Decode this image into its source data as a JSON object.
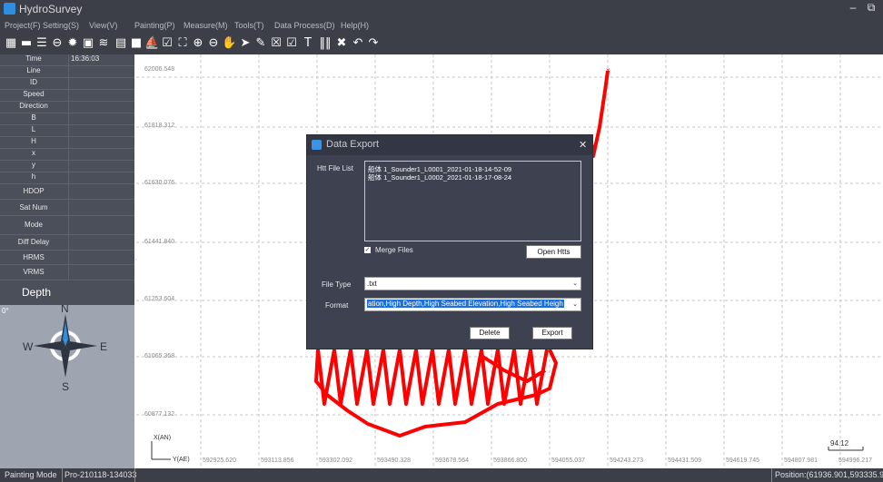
{
  "app": {
    "title": "HydroSurvey",
    "minimize": "–",
    "restore": "⧉"
  },
  "menu": [
    "Project(F)",
    "Setting(S)",
    "View(V)",
    "Painting(P)",
    "Measure(M)",
    "Tools(T)",
    "Data Process(D)",
    "Help(H)"
  ],
  "toolbar_icons": [
    "open-project-icon",
    "save-icon",
    "layers-icon",
    "link-icon",
    "settings-gear-icon",
    "image-icon",
    "lines-icon",
    "document-icon",
    "camera-icon",
    "boat-icon",
    "edit-icon",
    "fullscreen-icon",
    "zoom-in-icon",
    "zoom-out-icon",
    "pan-hand-icon",
    "pointer-icon",
    "pen-icon",
    "draw-icon",
    "edit-box-icon",
    "text-tool-icon",
    "barcode-icon",
    "delete-icon",
    "undo-icon",
    "redo-icon"
  ],
  "left_panel": {
    "rows": [
      {
        "label": "Time",
        "value": "16:36:03"
      },
      {
        "label": "Line",
        "value": ""
      },
      {
        "label": "ID",
        "value": ""
      },
      {
        "label": "Speed",
        "value": ""
      },
      {
        "label": "Direction",
        "value": ""
      },
      {
        "label": "B",
        "value": ""
      },
      {
        "label": "L",
        "value": ""
      },
      {
        "label": "H",
        "value": ""
      },
      {
        "label": "x",
        "value": ""
      },
      {
        "label": "y",
        "value": ""
      },
      {
        "label": "h",
        "value": ""
      },
      {
        "label": "HDOP",
        "value": ""
      },
      {
        "label": "Sat Num",
        "value": ""
      },
      {
        "label": "Mode",
        "value": ""
      },
      {
        "label": "Diff Delay",
        "value": ""
      },
      {
        "label": "HRMS",
        "value": ""
      },
      {
        "label": "VRMS",
        "value": ""
      }
    ],
    "depth_label": "Depth",
    "heading": "0°",
    "compass": {
      "n": "N",
      "s": "S",
      "e": "E",
      "w": "W"
    }
  },
  "map": {
    "y_ticks": [
      "62006.548",
      "61818.312",
      "61630.076",
      "61441.840",
      "61253.604",
      "61065.368",
      "60877.132"
    ],
    "x_ticks": [
      "592925.620",
      "593113.856",
      "593302.092",
      "593490.328",
      "593678.564",
      "593866.800",
      "594055.037",
      "594243.273",
      "594431.509",
      "594619.745",
      "594807.981",
      "594996.217"
    ],
    "axis_x": "X(AN)",
    "axis_y": "Y(AE)",
    "scale": "94.12",
    "track_color": "#ff0000"
  },
  "dialog": {
    "title": "Data Export",
    "close": "✕",
    "file_list_label": "Htt File List",
    "files": [
      "船体 1_Sounder1_L0001_2021-01-18-14-52-09",
      "船体 1_Sounder1_L0002_2021-01-18-17-08-24"
    ],
    "merge_files": "Merge Files",
    "merge_checked": true,
    "open_htts": "Open Htts",
    "file_type_label": "File Type",
    "file_type_value": ".txt",
    "format_label": "Format",
    "format_value": "ation,High Depth,High Seabed Elevation,High Seabed Heigh",
    "delete": "Delete",
    "export": "Export"
  },
  "status": {
    "mode": "Painting Mode",
    "project": "Pro-210118-134033",
    "position": "Position:(61936.901,593335.975)"
  }
}
